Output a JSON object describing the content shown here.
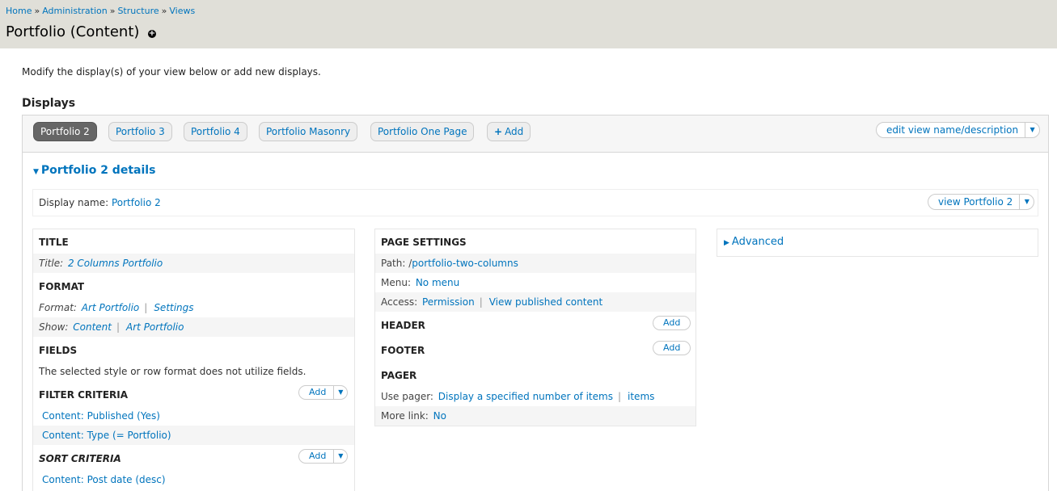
{
  "breadcrumb": [
    "Home",
    "Administration",
    "Structure",
    "Views"
  ],
  "breadcrumb_sep": "»",
  "page_title": "Portfolio (Content)",
  "intro": "Modify the display(s) of your view below or add new displays.",
  "displays_heading": "Displays",
  "tabs": [
    {
      "label": "Portfolio 2",
      "active": true
    },
    {
      "label": "Portfolio 3"
    },
    {
      "label": "Portfolio 4"
    },
    {
      "label": "Portfolio Masonry"
    },
    {
      "label": "Portfolio One Page"
    }
  ],
  "add_tab_label": "Add",
  "edit_view_label": "edit view name/description",
  "details_label": "Portfolio 2 details",
  "display_name": {
    "label": "Display name:",
    "value": "Portfolio 2"
  },
  "view_button_label": "view Portfolio 2",
  "col1": {
    "title_h": "TITLE",
    "title_row": {
      "label": "Title:",
      "value": "2 Columns Portfolio"
    },
    "format_h": "FORMAT",
    "format_row": {
      "label": "Format:",
      "value": "Art Portfolio",
      "extra": "Settings"
    },
    "show_row": {
      "label": "Show:",
      "value": "Content",
      "extra": "Art Portfolio"
    },
    "fields_h": "FIELDS",
    "fields_text": "The selected style or row format does not utilize fields.",
    "filter_h": "FILTER CRITERIA",
    "filter_items": [
      "Content: Published (Yes)",
      "Content: Type (= Portfolio)"
    ],
    "sort_h": "SORT CRITERIA",
    "sort_items": [
      "Content: Post date (desc)"
    ],
    "add_label": "Add"
  },
  "col2": {
    "page_h": "PAGE SETTINGS",
    "path_row": {
      "label": "Path:",
      "prefix": "/",
      "value": "portfolio-two-columns"
    },
    "menu_row": {
      "label": "Menu:",
      "value": "No menu"
    },
    "access_row": {
      "label": "Access:",
      "value": "Permission",
      "extra": "View published content"
    },
    "header_h": "HEADER",
    "footer_h": "FOOTER",
    "pager_h": "PAGER",
    "pager_row": {
      "label": "Use pager:",
      "value": "Display a specified number of items",
      "extra": "items"
    },
    "more_row": {
      "label": "More link:",
      "value": "No"
    },
    "add_label": "Add"
  },
  "col3": {
    "advanced_label": "Advanced"
  },
  "icons": {
    "shortcut": "plus-circle-icon",
    "caret": "caret-down-icon",
    "toggle_open": "triangle-down-icon",
    "toggle_closed": "triangle-right-icon"
  }
}
